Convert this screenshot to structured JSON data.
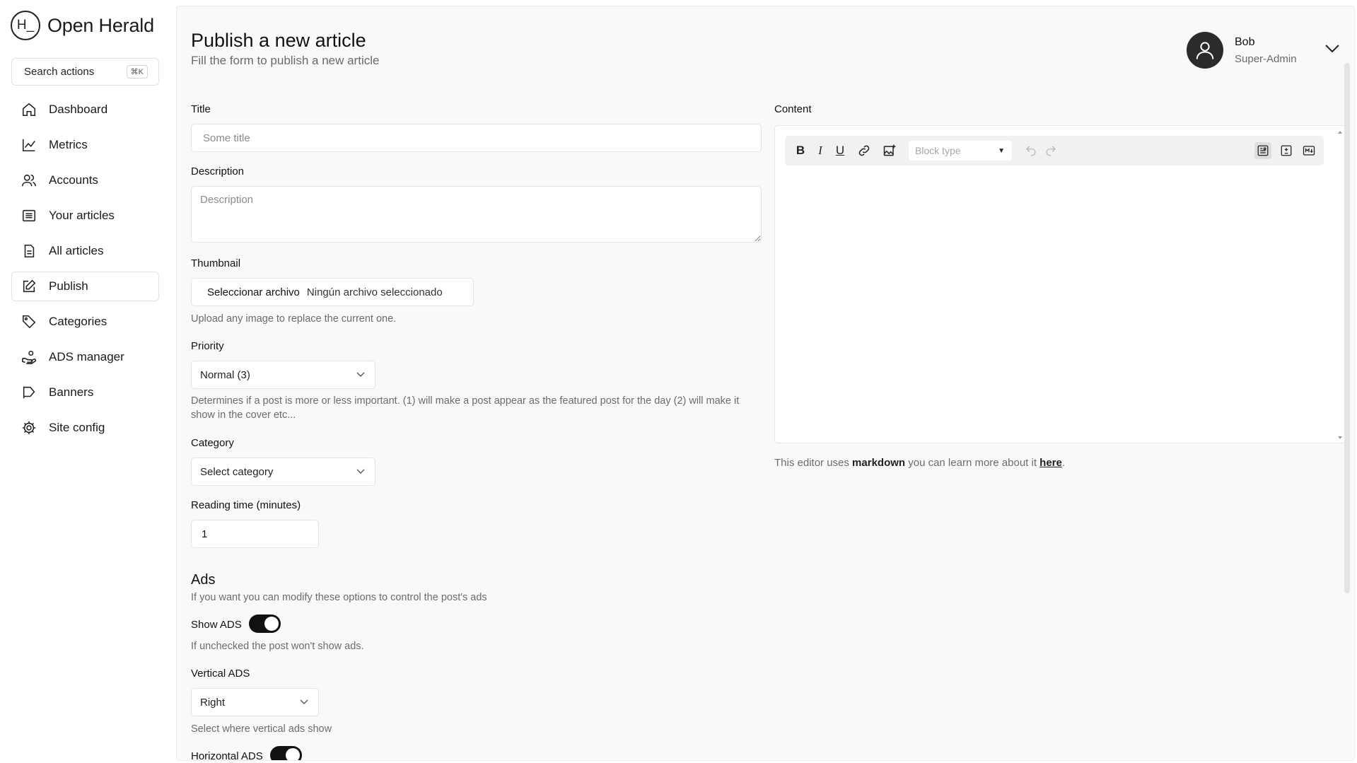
{
  "app": {
    "logo_mark": "H_",
    "name": "Open Herald"
  },
  "search": {
    "label": "Search actions",
    "shortcut": "⌘K"
  },
  "sidebar": {
    "items": [
      {
        "label": "Dashboard",
        "icon": "home-icon"
      },
      {
        "label": "Metrics",
        "icon": "chart-icon"
      },
      {
        "label": "Accounts",
        "icon": "users-icon"
      },
      {
        "label": "Your articles",
        "icon": "list-icon"
      },
      {
        "label": "All articles",
        "icon": "files-icon"
      },
      {
        "label": "Publish",
        "icon": "edit-icon",
        "active": true
      },
      {
        "label": "Categories",
        "icon": "tag-icon"
      },
      {
        "label": "ADS manager",
        "icon": "hand-coin-icon"
      },
      {
        "label": "Banners",
        "icon": "flag-icon"
      },
      {
        "label": "Site config",
        "icon": "gear-icon"
      }
    ]
  },
  "header": {
    "title": "Publish a new article",
    "subtitle": "Fill the form to publish a new article"
  },
  "user": {
    "name": "Bob",
    "role": "Super-Admin"
  },
  "form": {
    "title": {
      "label": "Title",
      "placeholder": "Some title"
    },
    "description": {
      "label": "Description",
      "placeholder": "Description"
    },
    "thumbnail": {
      "label": "Thumbnail",
      "button": "Seleccionar archivo",
      "file": "Ningún archivo seleccionado",
      "hint": "Upload any image to replace the current one."
    },
    "priority": {
      "label": "Priority",
      "value": "Normal (3)",
      "hint": "Determines if a post is more or less important. (1) will make a post appear as the featured post for the day (2) will make it show in the cover etc..."
    },
    "category": {
      "label": "Category",
      "value": "Select category"
    },
    "reading_time": {
      "label": "Reading time (minutes)",
      "value": "1"
    }
  },
  "ads": {
    "title": "Ads",
    "subtitle": "If you want you can modify these options to control the post's ads",
    "show_ads": {
      "label": "Show ADS",
      "on": true,
      "hint": "If unchecked the post won't show ads."
    },
    "vertical": {
      "label": "Vertical ADS",
      "value": "Right",
      "hint": "Select where vertical ads show"
    },
    "horizontal": {
      "label": "Horizontal ADS",
      "on": true
    }
  },
  "content": {
    "label": "Content",
    "block_type_placeholder": "Block type",
    "note_prefix": "This editor uses ",
    "note_bold": "markdown",
    "note_middle": " you can learn more about it ",
    "note_link": "here",
    "note_suffix": "."
  },
  "colors": {
    "accent": "#111111",
    "background": "#f9f9f9",
    "muted_text": "#6c6c6c"
  }
}
